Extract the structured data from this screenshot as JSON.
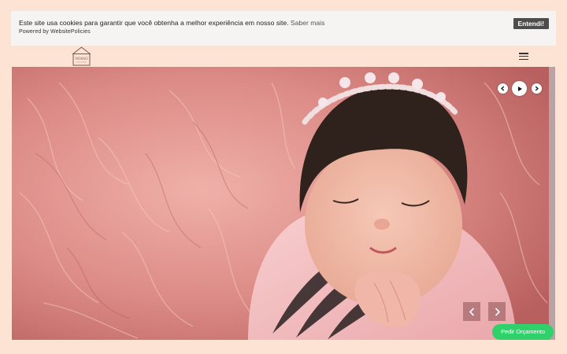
{
  "cookie_banner": {
    "message": "Este site usa cookies para garantir que você obtenha a melhor experiência em nosso site.",
    "link_text": "Saber mais",
    "powered_by": "Powered by WebsitePolicies",
    "button_label": "Entendi!"
  },
  "header": {
    "logo_text": "NOSSO",
    "menu_icon": "hamburger-menu-icon"
  },
  "hero": {
    "image_alt": "newborn baby sleeping on pink fur",
    "controls": {
      "prev_icon": "chevron-left-icon",
      "play_icon": "play-icon",
      "next_icon": "chevron-right-icon"
    },
    "nav": {
      "prev_icon": "chevron-left-icon",
      "next_icon": "chevron-right-icon"
    }
  },
  "cta": {
    "label": "Pedir Orçamento",
    "color": "#2fd26a"
  },
  "colors": {
    "page_background": "#fde3d4",
    "cookie_background": "#f6f4f3",
    "button_dark": "#4d4d4d"
  }
}
